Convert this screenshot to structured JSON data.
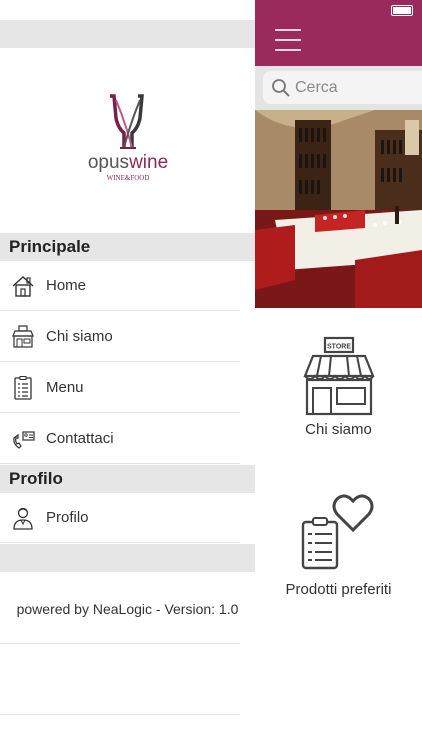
{
  "app": {
    "brand_primary": "opuswine",
    "brand_sub": "WINE & FOOD",
    "accent_color": "#9b2a5c"
  },
  "drawer": {
    "sections": [
      {
        "title": "Principale",
        "items": [
          {
            "label": "Home",
            "icon": "home-icon"
          },
          {
            "label": "Chi siamo",
            "icon": "store-icon"
          },
          {
            "label": "Menu",
            "icon": "menu-list-icon"
          },
          {
            "label": "Contattaci",
            "icon": "contact-icon"
          }
        ]
      },
      {
        "title": "Profilo",
        "items": [
          {
            "label": "Profilo",
            "icon": "user-icon"
          }
        ]
      }
    ],
    "footer": "powered by NeaLogic - Version: 1.0"
  },
  "main": {
    "search_placeholder": "Cerca",
    "tiles": [
      {
        "label": "Chi siamo",
        "icon": "store-icon"
      },
      {
        "label": "Prodotti preferiti",
        "icon": "favorites-icon"
      }
    ]
  }
}
